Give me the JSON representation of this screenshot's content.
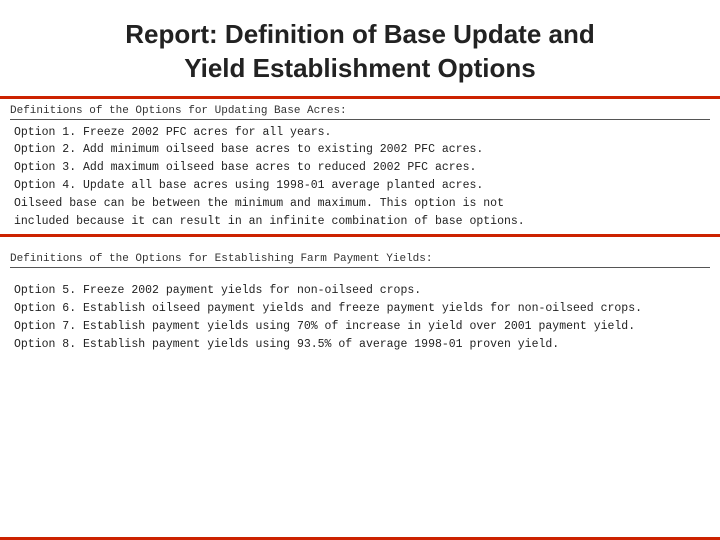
{
  "page": {
    "title_line1": "Report: Definition of Base Update and",
    "title_line2": "Yield Establishment Options"
  },
  "section1": {
    "header": "Definitions of the Options for Updating Base Acres:",
    "options": [
      "Option 1.  Freeze 2002 PFC acres for all years.",
      "Option 2.  Add minimum oilseed base acres to existing 2002 PFC acres.",
      "Option 3.  Add maximum oilseed base acres to reduced 2002 PFC acres.",
      "Option 4.  Update all base acres using 1998-01 average planted acres."
    ],
    "note_line1": "Oilseed base can be between the minimum and maximum. This option is not",
    "note_line2": "included because it can result in an infinite combination of base options."
  },
  "section2": {
    "header": "Definitions of the Options for Establishing Farm Payment Yields:",
    "options": [
      "Option 5.  Freeze 2002 payment yields for non-oilseed crops.",
      "Option 6.  Establish oilseed payment yields and freeze payment yields for non-oilseed crops.",
      "Option 7.  Establish payment yields using 70% of increase in yield over 2001 payment yield.",
      "Option 8.  Establish payment yields using 93.5% of average 1998-01 proven yield."
    ]
  }
}
